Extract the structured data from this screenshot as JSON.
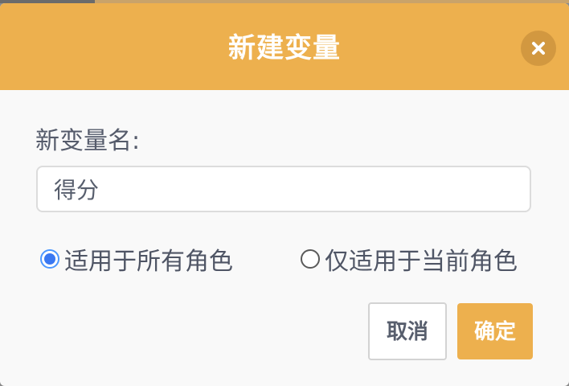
{
  "dialog": {
    "title": "新建变量",
    "close_icon": "close-icon",
    "field_label": "新变量名:",
    "input_value": "得分",
    "scope_options": [
      {
        "label": "适用于所有角色",
        "checked": true
      },
      {
        "label": "仅适用于当前角色",
        "checked": false
      }
    ],
    "cancel_label": "取消",
    "ok_label": "确定"
  },
  "colors": {
    "header": "#edb04e",
    "radio_checked": "#3a78f2",
    "text": "#575e6d"
  }
}
